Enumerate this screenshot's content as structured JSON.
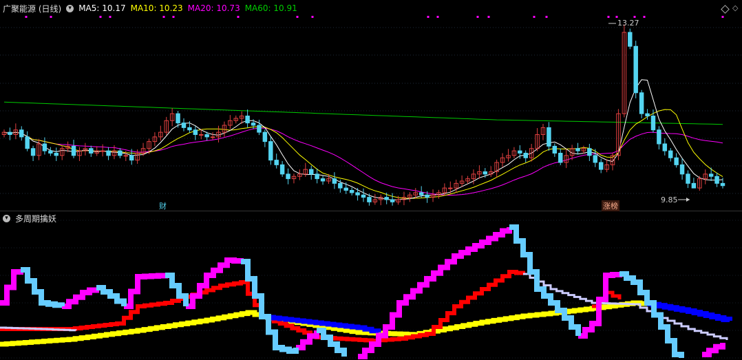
{
  "main_panel": {
    "title": "广聚能源 (日线)",
    "legend": [
      {
        "label": "MA5: 10.17",
        "color": "#ffffff"
      },
      {
        "label": "MA10: 10.23",
        "color": "#ffff00"
      },
      {
        "label": "MA20: 10.73",
        "color": "#ff00ff"
      },
      {
        "label": "MA60: 10.91",
        "color": "#00cc00"
      }
    ],
    "high_annotation": "13.27",
    "low_annotation": "9.85",
    "marker_cai": "财",
    "marker_zhangting": "涨榜"
  },
  "sub_panel": {
    "title": "多周期擒妖"
  },
  "colors": {
    "background": "#000000",
    "up_candle": "#e04040",
    "down_candle": "#54d4f0",
    "ma5": "#ffffff",
    "ma10": "#ffff00",
    "ma20": "#ff00ff",
    "ma60": "#00cc00",
    "wave_up": "#ff00ff",
    "wave_down": "#66ccff",
    "red_band": "#ff0000",
    "yellow_band": "#ffff00",
    "blue_band": "#0000ff",
    "lavender_band": "#ccccff"
  },
  "chart_data": {
    "type": "candlestick",
    "title": "广聚能源 (日线)",
    "ma_labels": {
      "MA5": 10.17,
      "MA10": 10.23,
      "MA20": 10.73,
      "MA60": 10.91
    },
    "ylim": [
      9.5,
      13.5
    ],
    "close": [
      10.95,
      10.9,
      11.0,
      10.85,
      10.6,
      10.45,
      10.7,
      10.55,
      10.5,
      10.45,
      10.6,
      10.65,
      10.45,
      10.55,
      10.6,
      10.5,
      10.55,
      10.55,
      10.45,
      10.55,
      10.45,
      10.45,
      10.35,
      10.5,
      10.6,
      10.75,
      10.85,
      10.95,
      11.2,
      11.35,
      11.15,
      11.05,
      11.0,
      10.9,
      10.9,
      10.85,
      10.85,
      10.95,
      11.1,
      11.2,
      11.25,
      11.3,
      11.15,
      11.1,
      10.95,
      10.75,
      10.35,
      10.25,
      10.05,
      9.95,
      10.0,
      10.05,
      10.15,
      10.05,
      9.95,
      9.9,
      9.95,
      9.85,
      9.75,
      9.7,
      9.65,
      9.6,
      9.55,
      9.45,
      9.5,
      9.55,
      9.5,
      9.45,
      9.5,
      9.55,
      9.6,
      9.65,
      9.6,
      9.55,
      9.6,
      9.65,
      9.75,
      9.75,
      9.85,
      9.9,
      9.95,
      10.05,
      10.1,
      10.05,
      10.1,
      10.3,
      10.4,
      10.45,
      10.55,
      10.5,
      10.4,
      10.6,
      10.9,
      11.05,
      10.65,
      10.5,
      10.3,
      10.45,
      10.6,
      10.55,
      10.6,
      10.45,
      10.3,
      10.15,
      10.25,
      10.45,
      11.35,
      13.1,
      12.8,
      11.8,
      11.35,
      11.3,
      11.0,
      10.7,
      10.55,
      10.4,
      10.25,
      10.05,
      9.85,
      9.75,
      9.95,
      10.05,
      10.0,
      9.85,
      9.8
    ]
  }
}
